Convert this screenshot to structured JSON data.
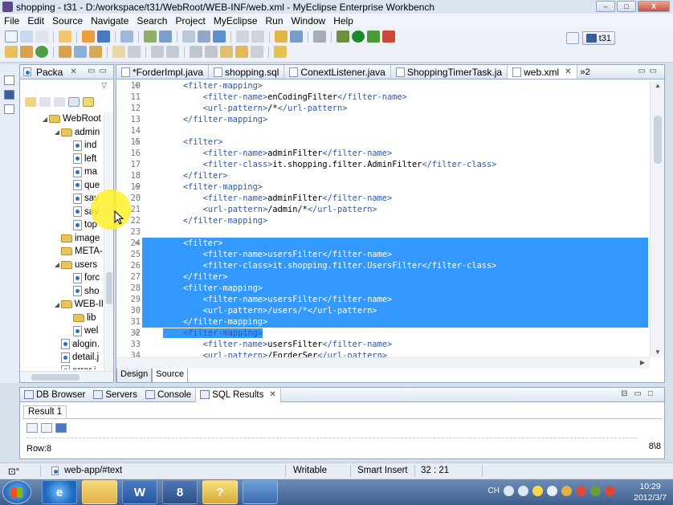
{
  "window": {
    "title": "shopping - t31 - D:/workspace/t31/WebRoot/WEB-INF/web.xml - MyEclipse Enterprise Workbench",
    "controls": [
      "–",
      "□",
      "X"
    ]
  },
  "menu": [
    "File",
    "Edit",
    "Source",
    "Navigate",
    "Search",
    "Project",
    "MyEclipse",
    "Run",
    "Window",
    "Help"
  ],
  "perspective": {
    "label": "t31"
  },
  "package_explorer": {
    "tab_label": "Packa",
    "tree": [
      {
        "label": "WebRoot",
        "type": "folder",
        "indent": 3,
        "expanded": true
      },
      {
        "label": "admin",
        "type": "folder",
        "indent": 4,
        "expanded": true
      },
      {
        "label": "ind",
        "type": "file",
        "indent": 5
      },
      {
        "label": "left",
        "type": "file",
        "indent": 5
      },
      {
        "label": "ma",
        "type": "file",
        "indent": 5
      },
      {
        "label": "que",
        "type": "file",
        "indent": 5
      },
      {
        "label": "sav",
        "type": "file",
        "indent": 5
      },
      {
        "label": "sav",
        "type": "file",
        "indent": 5
      },
      {
        "label": "top",
        "type": "file",
        "indent": 5
      },
      {
        "label": "image",
        "type": "folder",
        "indent": 4
      },
      {
        "label": "META-",
        "type": "folder",
        "indent": 4
      },
      {
        "label": "users",
        "type": "folder",
        "indent": 4,
        "expanded": true
      },
      {
        "label": "forc",
        "type": "file",
        "indent": 5
      },
      {
        "label": "sho",
        "type": "file",
        "indent": 5
      },
      {
        "label": "WEB-II",
        "type": "folder",
        "indent": 4,
        "expanded": true
      },
      {
        "label": "lib",
        "type": "folder",
        "indent": 5
      },
      {
        "label": "wel",
        "type": "file",
        "indent": 5
      },
      {
        "label": "alogin.",
        "type": "file",
        "indent": 4
      },
      {
        "label": "detail.j",
        "type": "file",
        "indent": 4
      },
      {
        "label": "error.i",
        "type": "file",
        "indent": 4
      }
    ]
  },
  "editor": {
    "tabs": [
      {
        "label": "*ForderImpl.java",
        "icon": "J"
      },
      {
        "label": "shopping.sql",
        "icon": "S"
      },
      {
        "label": "ConextListener.java",
        "icon": "J"
      },
      {
        "label": "ShoppingTimerTask.ja",
        "icon": "J"
      },
      {
        "label": "web.xml",
        "icon": "X",
        "active": true
      }
    ],
    "overflow_label": "»2",
    "lines": [
      {
        "n": "10",
        "fold": true,
        "text": "    <filter-mapping>"
      },
      {
        "n": "11",
        "text": "        <filter-name>enCodingFilter</filter-name>"
      },
      {
        "n": "12",
        "text": "        <url-pattern>/*</url-pattern>"
      },
      {
        "n": "13",
        "text": "    </filter-mapping>"
      },
      {
        "n": "14",
        "text": ""
      },
      {
        "n": "15",
        "fold": true,
        "text": "    <filter>"
      },
      {
        "n": "16",
        "text": "        <filter-name>adminFilter</filter-name>"
      },
      {
        "n": "17",
        "text": "        <filter-class>it.shopping.filter.AdminFilter</filter-class>"
      },
      {
        "n": "18",
        "text": "    </filter>"
      },
      {
        "n": "19",
        "fold": true,
        "text": "    <filter-mapping>"
      },
      {
        "n": "20",
        "text": "        <filter-name>adminFilter</filter-name>"
      },
      {
        "n": "21",
        "text": "        <url-pattern>/admin/*</url-pattern>"
      },
      {
        "n": "22",
        "text": "    </filter-mapping>"
      },
      {
        "n": "23",
        "text": ""
      },
      {
        "n": "24",
        "fold": true,
        "text": "    <filter>",
        "sel": true
      },
      {
        "n": "25",
        "text": "        <filter-name>usersFilter</filter-name>",
        "sel": true
      },
      {
        "n": "26",
        "text": "        <filter-class>it.shopping.filter.UsersFilter</filter-class>",
        "sel": true
      },
      {
        "n": "27",
        "text": "    </filter>",
        "sel": true
      },
      {
        "n": "28",
        "text": "    <filter-mapping>",
        "sel": true
      },
      {
        "n": "29",
        "text": "        <filter-name>usersFilter</filter-name>",
        "sel": true
      },
      {
        "n": "30",
        "text": "        <url-pattern>/users/*</url-pattern>",
        "sel": true
      },
      {
        "n": "31",
        "text": "    </filter-mapping>",
        "sel": true
      },
      {
        "n": "32",
        "fold": true,
        "text": "    <filter-mapping>",
        "part": true
      },
      {
        "n": "33",
        "text": "        <filter-name>usersFilter</filter-name>"
      },
      {
        "n": "34",
        "text": "        <url-pattern>/ForderSer</url-pattern>"
      }
    ],
    "bottom_tabs": [
      "Design",
      "Source"
    ]
  },
  "bottom_panel": {
    "tabs": [
      {
        "label": "DB Browser"
      },
      {
        "label": "Servers"
      },
      {
        "label": "Console"
      },
      {
        "label": "SQL Results",
        "active": true
      }
    ],
    "result_tab": "Result 1",
    "row_label": "Row:8",
    "row_ratio": "8\\8"
  },
  "status": {
    "path": "web-app/#text",
    "mode": "Writable",
    "insert": "Smart Insert",
    "position": "32 : 21"
  },
  "taskbar": {
    "lang": "CH",
    "time": "10:29",
    "date": "2012/3/7"
  },
  "colors": {
    "selection": "#3399ff",
    "tag": "#2f5aa6"
  }
}
